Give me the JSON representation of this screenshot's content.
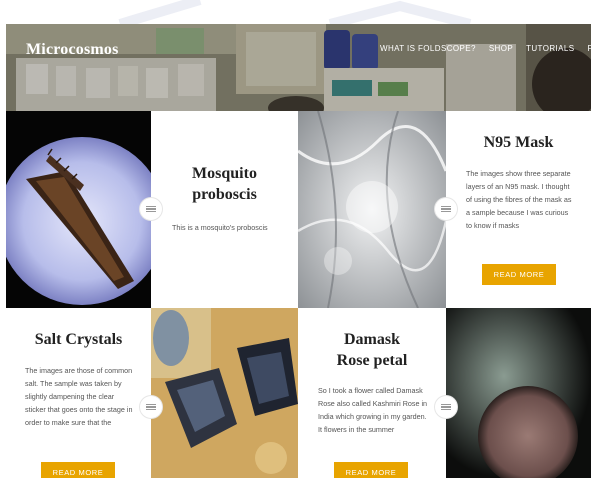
{
  "header": {
    "brand": "Microcosmos",
    "nav": [
      "WHAT IS FOLDSCOPE?",
      "SHOP",
      "TUTORIALS",
      "FO"
    ]
  },
  "posts": [
    {
      "title_line1": "Mosquito",
      "title_line2": "proboscis",
      "excerpt": "This is a mosquito's proboscis"
    },
    {
      "title_line1": "N95 Mask",
      "excerpt": "The images show three separate layers of an N95 mask. I thought of using the fibres of the mask as a sample because I was curious to know if masks",
      "button": "READ MORE"
    },
    {
      "title_line1": "Salt Crystals",
      "excerpt": "The images are those of common salt. The sample was taken by slightly dampening the clear sticker that goes onto the stage in order to make sure that the",
      "button": "READ MORE"
    },
    {
      "title_line1": "Damask",
      "title_line2": "Rose petal",
      "excerpt": "So I took a flower called Damask Rose also called Kashmiri Rose in India which growing in my garden. It flowers in the summer",
      "button": "READ MORE"
    }
  ],
  "icons": {
    "post-format": "post-format-icon"
  },
  "colors": {
    "accent": "#e8a400",
    "text_dark": "#222222",
    "text_body": "#555555"
  }
}
